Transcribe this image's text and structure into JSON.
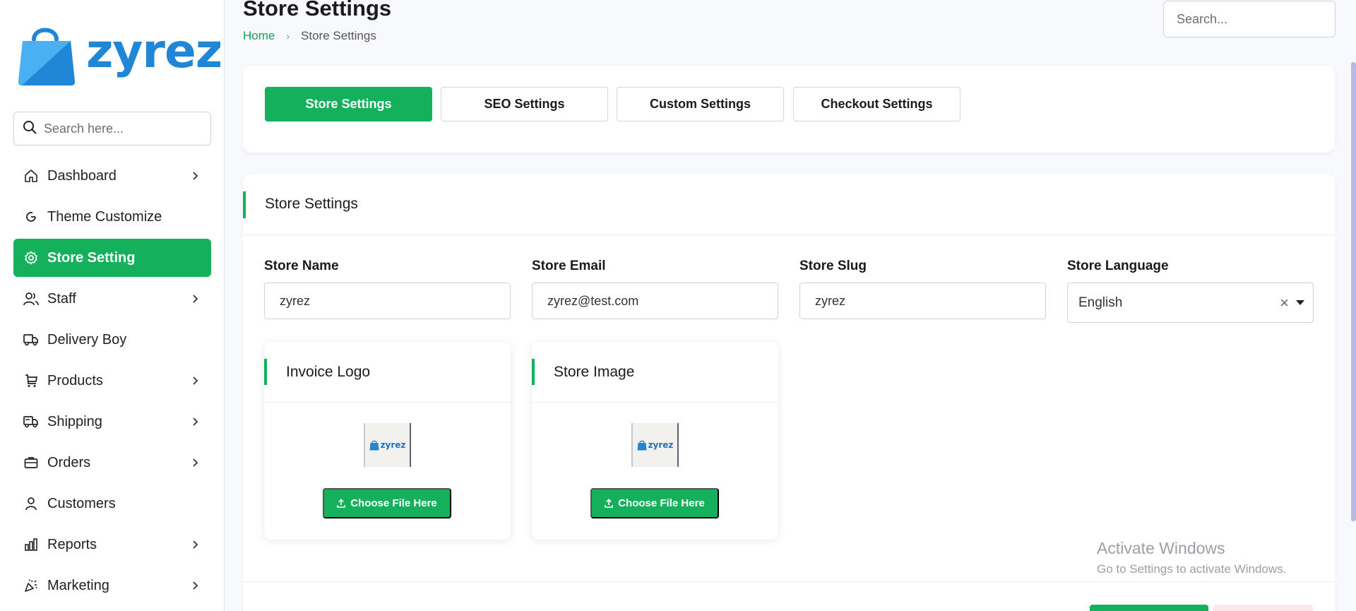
{
  "app": {
    "logo_text": "zyrez",
    "brand_color": "#1f87d6",
    "accent_color": "#15b05b"
  },
  "sidebar": {
    "search_placeholder": "Search here...",
    "items": [
      {
        "label": "Dashboard",
        "icon": "home-icon",
        "has_chevron": true,
        "active": false
      },
      {
        "label": "Theme Customize",
        "icon": "refresh-icon",
        "has_chevron": false,
        "active": false
      },
      {
        "label": "Store Setting",
        "icon": "gear-icon",
        "has_chevron": false,
        "active": true
      },
      {
        "label": "Staff",
        "icon": "users-icon",
        "has_chevron": true,
        "active": false
      },
      {
        "label": "Delivery Boy",
        "icon": "truck-icon",
        "has_chevron": false,
        "active": false
      },
      {
        "label": "Products",
        "icon": "cart-icon",
        "has_chevron": true,
        "active": false
      },
      {
        "label": "Shipping",
        "icon": "shipping-truck-icon",
        "has_chevron": true,
        "active": false
      },
      {
        "label": "Orders",
        "icon": "briefcase-icon",
        "has_chevron": true,
        "active": false
      },
      {
        "label": "Customers",
        "icon": "user-icon",
        "has_chevron": false,
        "active": false
      },
      {
        "label": "Reports",
        "icon": "bar-chart-icon",
        "has_chevron": true,
        "active": false
      },
      {
        "label": "Marketing",
        "icon": "party-icon",
        "has_chevron": true,
        "active": false
      }
    ]
  },
  "header": {
    "title": "Store Settings",
    "breadcrumb": {
      "home": "Home",
      "separator": "›",
      "current": "Store Settings"
    },
    "search_placeholder": "Search..."
  },
  "tabs": [
    {
      "label": "Store Settings",
      "active": true
    },
    {
      "label": "SEO Settings",
      "active": false
    },
    {
      "label": "Custom Settings",
      "active": false
    },
    {
      "label": "Checkout Settings",
      "active": false
    }
  ],
  "form": {
    "section_title": "Store Settings",
    "store_name": {
      "label": "Store Name",
      "value": "zyrez"
    },
    "store_email": {
      "label": "Store Email",
      "value": "zyrez@test.com"
    },
    "store_slug": {
      "label": "Store Slug",
      "value": "zyrez"
    },
    "store_language": {
      "label": "Store Language",
      "value": "English",
      "clear": "×"
    },
    "invoice_logo": {
      "title": "Invoice Logo",
      "thumb_text": "zyrez",
      "button": "Choose File Here"
    },
    "store_image": {
      "title": "Store Image",
      "thumb_text": "zyrez",
      "button": "Choose File Here"
    }
  },
  "watermark": {
    "line1": "Activate Windows",
    "line2": "Go to Settings to activate Windows."
  }
}
